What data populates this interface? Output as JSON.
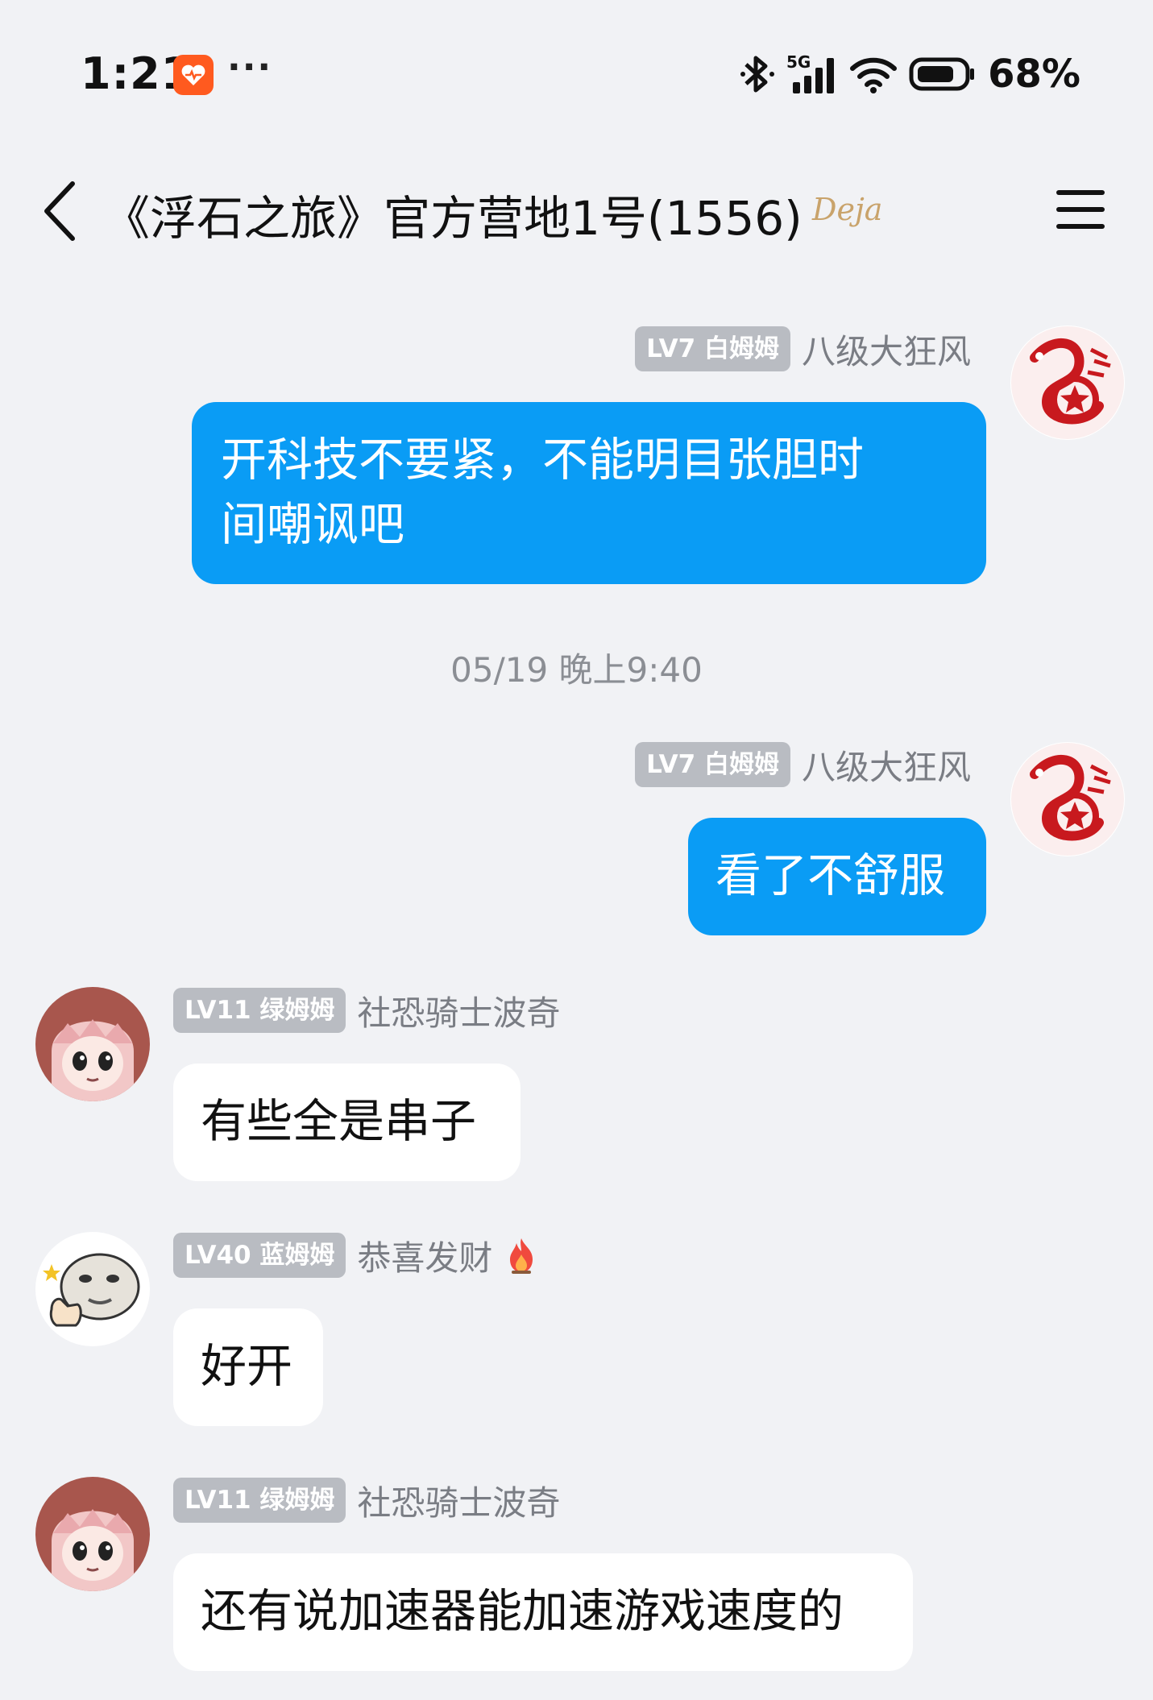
{
  "status_bar": {
    "time": "1:21",
    "more": "···",
    "network": "5G",
    "battery": "68%"
  },
  "header": {
    "title": "《浮石之旅》官方营地1号(1556)",
    "badge": "Deja"
  },
  "messages": [
    {
      "direction": "out",
      "level": "LV7 白姆姆",
      "sender": "八级大狂风",
      "text": "开科技不要紧，不能明目张胆时间嘲讽吧",
      "line1": "开科技不要紧，不能明目张胆时",
      "line2": "间嘲讽吧"
    },
    {
      "direction": "out",
      "level": "LV7 白姆姆",
      "sender": "八级大狂风",
      "text": "看了不舒服"
    },
    {
      "direction": "in",
      "level": "LV11 绿姆姆",
      "sender": "社恐骑士波奇",
      "text": "有些全是串子"
    },
    {
      "direction": "in",
      "level": "LV40 蓝姆姆",
      "sender": "恭喜发财",
      "text": "好开"
    },
    {
      "direction": "in",
      "level": "LV11 绿姆姆",
      "sender": "社恐骑士波奇",
      "text": "还有说加速器能加速游戏速度的"
    }
  ],
  "time_divider": "05/19 晚上9:40",
  "colors": {
    "background": "#f1f2f5",
    "outgoing_bubble": "#0a9cf5",
    "incoming_bubble": "#ffffff",
    "level_badge": "#b9bcc2"
  },
  "icons": [
    "heart-pulse-app-icon",
    "bluetooth-icon",
    "signal-icon",
    "wifi-icon",
    "battery-icon",
    "back-chevron-icon",
    "menu-icon",
    "fire-icon"
  ]
}
